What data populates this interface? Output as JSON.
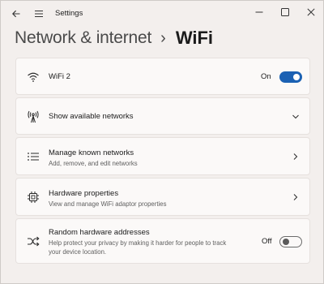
{
  "window": {
    "app_title": "Settings"
  },
  "breadcrumb": {
    "parent": "Network & internet",
    "separator": "›",
    "current": "WiFi"
  },
  "wifi_card": {
    "title": "WiFi 2",
    "state_label": "On",
    "enabled": true,
    "icon": "wifi-icon"
  },
  "available_networks": {
    "title": "Show available networks",
    "icon": "antenna-icon"
  },
  "known_networks": {
    "title": "Manage known networks",
    "subtitle": "Add, remove, and edit networks",
    "icon": "list-icon"
  },
  "hardware_properties": {
    "title": "Hardware properties",
    "subtitle": "View and manage WiFi adaptor properties",
    "icon": "chip-icon"
  },
  "random_addresses": {
    "title": "Random hardware addresses",
    "subtitle_line1": "Help protect your privacy by making it harder for people to track",
    "subtitle_line2": "your device location.",
    "state_label": "Off",
    "enabled": false,
    "icon": "shuffle-icon"
  },
  "colors": {
    "accent": "#1b61b3",
    "background": "#f3efed",
    "card": "#fbf9f8"
  }
}
